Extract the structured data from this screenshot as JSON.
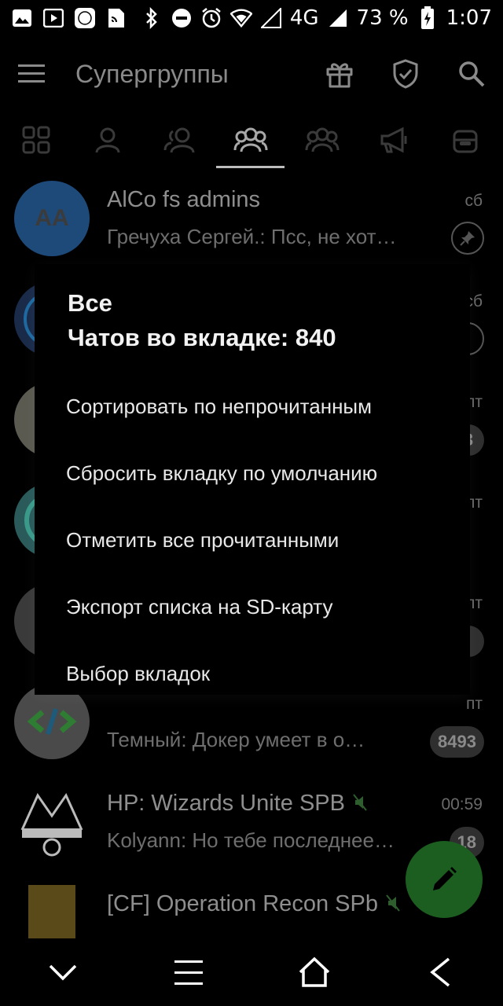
{
  "status_bar": {
    "battery": "73 %",
    "network": "4G",
    "time": "1:07",
    "icons": [
      "gallery-icon",
      "youtube-icon",
      "mi-icon",
      "sim-icon",
      "bluetooth-icon",
      "dnd-icon",
      "alarm-icon",
      "wifi-icon",
      "signal-icon",
      "battery-icon"
    ]
  },
  "appbar": {
    "title": "Супергруппы"
  },
  "tabs": [
    {
      "icon": "grid-icon",
      "active": false
    },
    {
      "icon": "user-icon",
      "active": false
    },
    {
      "icon": "two-users-icon",
      "active": false
    },
    {
      "icon": "group-icon",
      "active": true
    },
    {
      "icon": "group-alt-icon",
      "active": false
    },
    {
      "icon": "megaphone-icon",
      "active": false
    },
    {
      "icon": "bot-icon",
      "active": false
    }
  ],
  "chats": [
    {
      "avatar_text": "AA",
      "name": "AlCo fs admins",
      "message": "Гречуха Сергей.: Псс, не хот…",
      "time": "сб",
      "badge": ""
    },
    {
      "avatar_text": "",
      "name": "",
      "message": "",
      "time": "сб",
      "badge": ""
    },
    {
      "avatar_text": "",
      "name": "",
      "message": "",
      "time": "пт",
      "badge": ""
    },
    {
      "avatar_text": "",
      "name": "",
      "message": "",
      "time": "пт",
      "badge": ""
    },
    {
      "avatar_text": "",
      "name": "",
      "message": "",
      "time": "пт",
      "badge": ""
    },
    {
      "avatar_text": "",
      "name": "",
      "message": "Темный: Докер умеет в о…",
      "time": "пт",
      "badge": "8493"
    },
    {
      "avatar_text": "",
      "name": "HP: Wizards Unite SPB",
      "message": "Kolyann: Но тебе последнее…",
      "time": "00:59",
      "badge": "18"
    },
    {
      "avatar_text": "",
      "name": "[CF] Operation Recon SPb",
      "message": "",
      "time": "",
      "badge": ""
    }
  ],
  "popup": {
    "title": "Все",
    "subtitle": "Чатов во вкладке: 840",
    "items": [
      "Сортировать по непрочитанным",
      "Сбросить вкладку по умолчанию",
      "Отметить все прочитанными",
      "Экспорт списка на SD-карту",
      "Выбор вкладок"
    ]
  },
  "colors": {
    "background": "#000000",
    "fab": "#1b5e20",
    "muted_text": "#8e8e8e",
    "avatar_aa": "#1e4a7a"
  }
}
